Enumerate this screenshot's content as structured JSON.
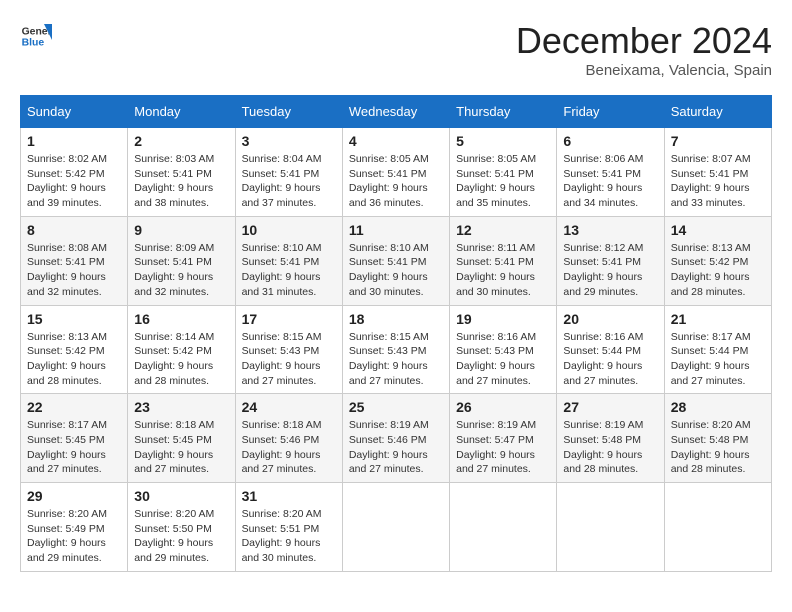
{
  "header": {
    "logo_line1": "General",
    "logo_line2": "Blue",
    "month": "December 2024",
    "location": "Beneixama, Valencia, Spain"
  },
  "weekdays": [
    "Sunday",
    "Monday",
    "Tuesday",
    "Wednesday",
    "Thursday",
    "Friday",
    "Saturday"
  ],
  "weeks": [
    [
      {
        "day": "1",
        "sunrise": "8:02 AM",
        "sunset": "5:42 PM",
        "daylight": "9 hours and 39 minutes."
      },
      {
        "day": "2",
        "sunrise": "8:03 AM",
        "sunset": "5:41 PM",
        "daylight": "9 hours and 38 minutes."
      },
      {
        "day": "3",
        "sunrise": "8:04 AM",
        "sunset": "5:41 PM",
        "daylight": "9 hours and 37 minutes."
      },
      {
        "day": "4",
        "sunrise": "8:05 AM",
        "sunset": "5:41 PM",
        "daylight": "9 hours and 36 minutes."
      },
      {
        "day": "5",
        "sunrise": "8:05 AM",
        "sunset": "5:41 PM",
        "daylight": "9 hours and 35 minutes."
      },
      {
        "day": "6",
        "sunrise": "8:06 AM",
        "sunset": "5:41 PM",
        "daylight": "9 hours and 34 minutes."
      },
      {
        "day": "7",
        "sunrise": "8:07 AM",
        "sunset": "5:41 PM",
        "daylight": "9 hours and 33 minutes."
      }
    ],
    [
      {
        "day": "8",
        "sunrise": "8:08 AM",
        "sunset": "5:41 PM",
        "daylight": "9 hours and 32 minutes."
      },
      {
        "day": "9",
        "sunrise": "8:09 AM",
        "sunset": "5:41 PM",
        "daylight": "9 hours and 32 minutes."
      },
      {
        "day": "10",
        "sunrise": "8:10 AM",
        "sunset": "5:41 PM",
        "daylight": "9 hours and 31 minutes."
      },
      {
        "day": "11",
        "sunrise": "8:10 AM",
        "sunset": "5:41 PM",
        "daylight": "9 hours and 30 minutes."
      },
      {
        "day": "12",
        "sunrise": "8:11 AM",
        "sunset": "5:41 PM",
        "daylight": "9 hours and 30 minutes."
      },
      {
        "day": "13",
        "sunrise": "8:12 AM",
        "sunset": "5:41 PM",
        "daylight": "9 hours and 29 minutes."
      },
      {
        "day": "14",
        "sunrise": "8:13 AM",
        "sunset": "5:42 PM",
        "daylight": "9 hours and 28 minutes."
      }
    ],
    [
      {
        "day": "15",
        "sunrise": "8:13 AM",
        "sunset": "5:42 PM",
        "daylight": "9 hours and 28 minutes."
      },
      {
        "day": "16",
        "sunrise": "8:14 AM",
        "sunset": "5:42 PM",
        "daylight": "9 hours and 28 minutes."
      },
      {
        "day": "17",
        "sunrise": "8:15 AM",
        "sunset": "5:43 PM",
        "daylight": "9 hours and 27 minutes."
      },
      {
        "day": "18",
        "sunrise": "8:15 AM",
        "sunset": "5:43 PM",
        "daylight": "9 hours and 27 minutes."
      },
      {
        "day": "19",
        "sunrise": "8:16 AM",
        "sunset": "5:43 PM",
        "daylight": "9 hours and 27 minutes."
      },
      {
        "day": "20",
        "sunrise": "8:16 AM",
        "sunset": "5:44 PM",
        "daylight": "9 hours and 27 minutes."
      },
      {
        "day": "21",
        "sunrise": "8:17 AM",
        "sunset": "5:44 PM",
        "daylight": "9 hours and 27 minutes."
      }
    ],
    [
      {
        "day": "22",
        "sunrise": "8:17 AM",
        "sunset": "5:45 PM",
        "daylight": "9 hours and 27 minutes."
      },
      {
        "day": "23",
        "sunrise": "8:18 AM",
        "sunset": "5:45 PM",
        "daylight": "9 hours and 27 minutes."
      },
      {
        "day": "24",
        "sunrise": "8:18 AM",
        "sunset": "5:46 PM",
        "daylight": "9 hours and 27 minutes."
      },
      {
        "day": "25",
        "sunrise": "8:19 AM",
        "sunset": "5:46 PM",
        "daylight": "9 hours and 27 minutes."
      },
      {
        "day": "26",
        "sunrise": "8:19 AM",
        "sunset": "5:47 PM",
        "daylight": "9 hours and 27 minutes."
      },
      {
        "day": "27",
        "sunrise": "8:19 AM",
        "sunset": "5:48 PM",
        "daylight": "9 hours and 28 minutes."
      },
      {
        "day": "28",
        "sunrise": "8:20 AM",
        "sunset": "5:48 PM",
        "daylight": "9 hours and 28 minutes."
      }
    ],
    [
      {
        "day": "29",
        "sunrise": "8:20 AM",
        "sunset": "5:49 PM",
        "daylight": "9 hours and 29 minutes."
      },
      {
        "day": "30",
        "sunrise": "8:20 AM",
        "sunset": "5:50 PM",
        "daylight": "9 hours and 29 minutes."
      },
      {
        "day": "31",
        "sunrise": "8:20 AM",
        "sunset": "5:51 PM",
        "daylight": "9 hours and 30 minutes."
      },
      null,
      null,
      null,
      null
    ]
  ]
}
